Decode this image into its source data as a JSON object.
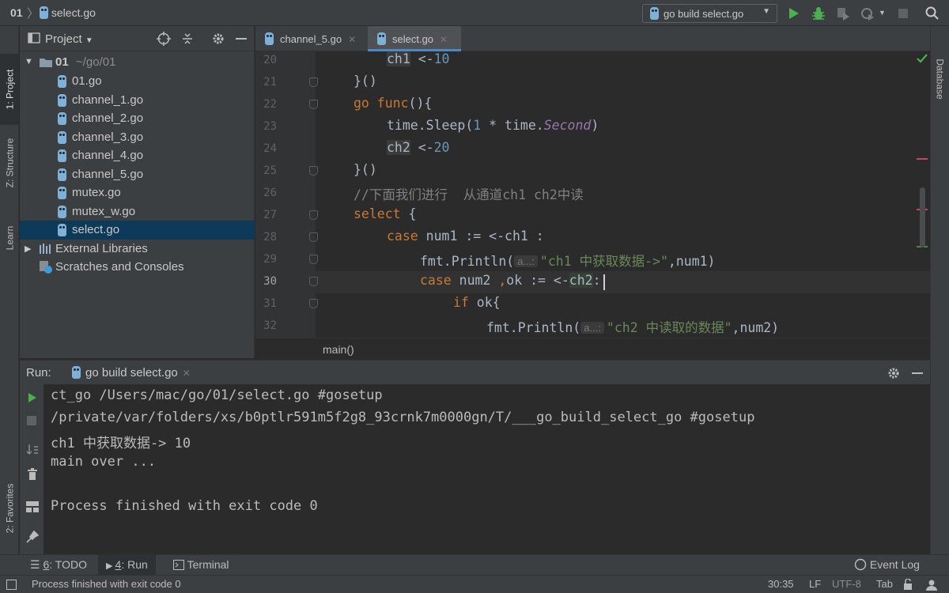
{
  "titlebar": {
    "project": "01",
    "separator": "〉",
    "file": "select.go",
    "run_config": "go build select.go"
  },
  "left_strip": {
    "project_tab": "1: Project",
    "structure_tab": "Z: Structure",
    "learn_tab": "Learn",
    "favorites_tab": "2: Favorites"
  },
  "right_strip": {
    "database_tab": "Database"
  },
  "project_panel": {
    "title": "Project",
    "root_name": "01",
    "root_path": "~/go/01",
    "files": [
      "01.go",
      "channel_1.go",
      "channel_2.go",
      "channel_3.go",
      "channel_4.go",
      "channel_5.go",
      "mutex.go",
      "mutex_w.go",
      "select.go"
    ],
    "external_libraries": "External Libraries",
    "scratches": "Scratches and Consoles"
  },
  "editor": {
    "tabs": [
      "channel_5.go",
      "select.go"
    ],
    "active_tab": "select.go",
    "line_numbers": [
      "20",
      "21",
      "22",
      "23",
      "24",
      "25",
      "26",
      "27",
      "28",
      "29",
      "30",
      "31",
      "32"
    ],
    "current_line": "30",
    "hint": "a...:",
    "breadcrumb": "main()",
    "code": {
      "l20_ident": "ch1",
      "l20_op": " <-",
      "l20_num": "10",
      "l21": "}()",
      "l22_kw": "go func",
      "l22_rest": "(){",
      "l23_a": "time.",
      "l23_b": "Sleep(",
      "l23_num": "1",
      "l23_c": " * time.",
      "l23_it": "Second",
      "l23_d": ")",
      "l24_ident": "ch2",
      "l24_op": " <-",
      "l24_num": "20",
      "l25": "}()",
      "l26": "//下面我们进行  从通道ch1 ch2中读",
      "l27_kw": "select",
      "l27_rest": " {",
      "l28_kw": "case",
      "l28_rest": " num1 := <-ch1 :",
      "l29_a": "fmt.Println(",
      "l29_str": "\"ch1 中获取数据->\"",
      "l29_b": ",num1)",
      "l30_kw": "case",
      "l30_a": " num2 ",
      "l30_comma": ",",
      "l30_b": "ok := <-",
      "l30_c": "ch2",
      "l30_d": ":",
      "l31_kw": "if",
      "l31_rest": " ok{",
      "l32_a": "fmt.Println(",
      "l32_str": "\"ch2 中读取的数据\"",
      "l32_b": ",num2)"
    }
  },
  "run_panel": {
    "label": "Run:",
    "tab": "go build select.go",
    "output": [
      "ct_go /Users/mac/go/01/select.go #gosetup",
      "/private/var/folders/xs/b0ptlr591m5f2g8_93crnk7m0000gn/T/___go_build_select_go #gosetup",
      "ch1 中获取数据-> 10",
      "main over ...",
      "",
      "Process finished with exit code 0"
    ]
  },
  "bottom_tabs": {
    "todo_num": "6",
    "todo": ": TODO",
    "run_num": "4",
    "run": ": Run",
    "terminal": "Terminal",
    "event_log": "Event Log"
  },
  "status_bar": {
    "message": "Process finished with exit code 0",
    "position": "30:35",
    "line_sep": "LF",
    "encoding": "UTF-8",
    "indent": "Tab"
  },
  "colors": {
    "background": "#2b2b2b",
    "panel": "#3c3f41",
    "selection": "#0d3a58",
    "keyword": "#cc7832",
    "number": "#6897bb",
    "string": "#6a8759",
    "run_green": "#4caf50"
  }
}
